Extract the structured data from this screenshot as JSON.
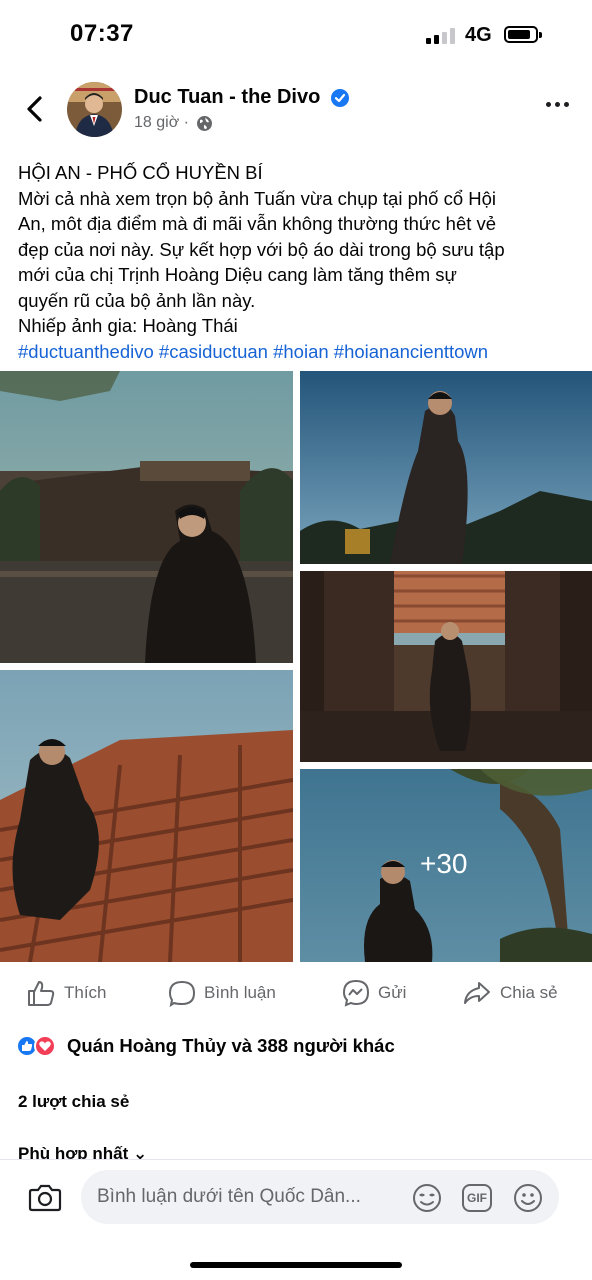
{
  "status_bar": {
    "time": "07:37",
    "network": "4G"
  },
  "post": {
    "author": "Duc Tuan - the Divo",
    "timestamp": "18 giờ ·",
    "text_lines": [
      "HỘI AN - PHỐ CỔ HUYỀN BÍ",
      "Mời cả nhà xem trọn bộ ảnh Tuấn vừa chụp tại phố cổ Hội",
      "An, môt địa điểm mà đi mãi vẫn không thường thức hêt vẻ",
      "đẹp của nơi này. Sự kết hợp với bộ áo dài trong bộ sưu tập",
      "mới của chị Trịnh Hoàng Diệu cang làm tăng thêm sự",
      "quyến rũ của bộ ảnh lần này.",
      "Nhiếp ảnh gia: Hoàng Thái"
    ],
    "hashtags": [
      "#ductuanthedivo",
      "#casiductuan",
      "#hoian",
      "#hoianancienttown"
    ],
    "more_photos": "+30"
  },
  "actions": {
    "like": "Thích",
    "comment": "Bình luận",
    "send": "Gửi",
    "share": "Chia sẻ"
  },
  "reactions": {
    "summary": "Quán Hoàng Thủy và 388 người khác",
    "shares": "2 lượt chia sẻ",
    "sort": "Phù hợp nhất ⌄"
  },
  "comment_bar": {
    "placeholder": "Bình luận dưới tên Quốc Dân...",
    "gif": "GIF"
  },
  "colors": {
    "link": "#1763d6",
    "like": "#1877f2",
    "love": "#f33e58",
    "muted": "#65676b"
  }
}
